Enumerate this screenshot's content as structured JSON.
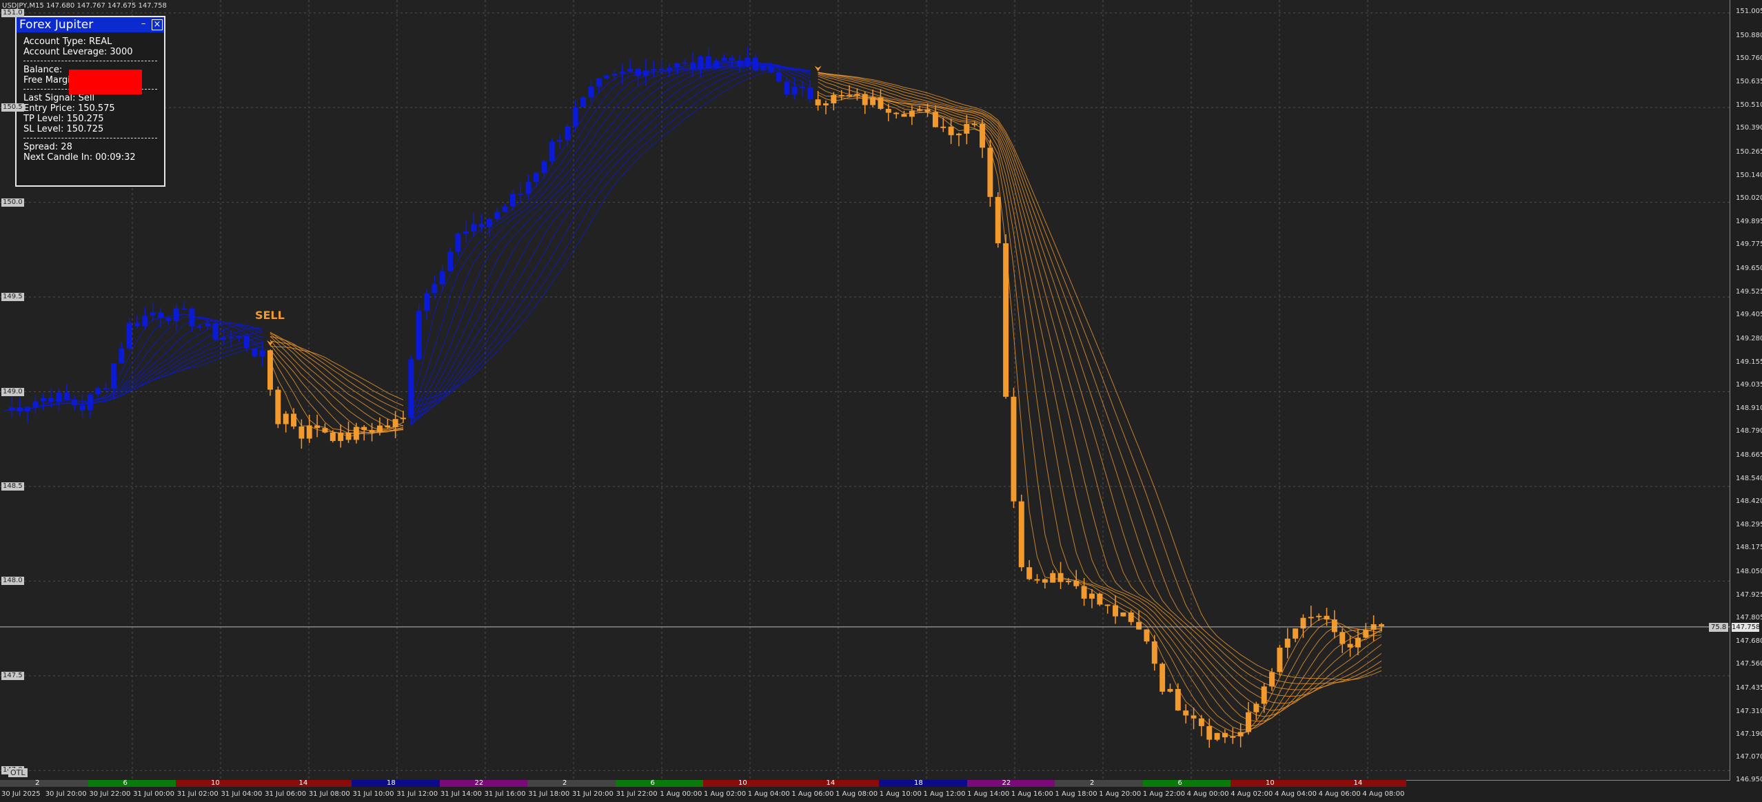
{
  "header": {
    "symbol_info": "USDJPY,M15  147.680 147.767 147.675 147.758"
  },
  "panel": {
    "title": "Forex Jupiter",
    "minimize": "–",
    "close": "×",
    "account_type": "Account Type: REAL",
    "leverage": "Account Leverage: 3000",
    "balance": "Balance:",
    "free_margin": "Free Margin",
    "last_signal": "Last Signal: Sell",
    "entry_price": "Entry Price: 150.575",
    "tp_level": "TP Level: 150.275",
    "sl_level": "SL Level: 150.725",
    "spread": "Spread: 28",
    "next_candle": "Next Candle In: 00:09:32"
  },
  "signals": {
    "sell_label": "SELL"
  },
  "price_axis": [
    "151.005",
    "150.880",
    "150.760",
    "150.635",
    "150.510",
    "150.390",
    "150.265",
    "150.140",
    "150.020",
    "149.895",
    "149.775",
    "149.650",
    "149.525",
    "149.405",
    "149.280",
    "149.155",
    "149.035",
    "148.910",
    "148.790",
    "148.665",
    "148.540",
    "148.420",
    "148.295",
    "148.175",
    "148.050",
    "147.925",
    "147.805",
    "147.680",
    "147.560",
    "147.435",
    "147.310",
    "147.190",
    "147.070",
    "146.950"
  ],
  "left_levels": [
    "151.0",
    "150.5",
    "150.0",
    "149.5",
    "149.0",
    "148.5",
    "148.0",
    "147.5",
    "147.0"
  ],
  "current_price": "147.758",
  "current_price_left": "75.8",
  "time_axis": [
    "30 Jul 2025",
    "30 Jul 20:00",
    "30 Jul 22:00",
    "31 Jul 00:00",
    "31 Jul 02:00",
    "31 Jul 04:00",
    "31 Jul 06:00",
    "31 Jul 08:00",
    "31 Jul 10:00",
    "31 Jul 12:00",
    "31 Jul 14:00",
    "31 Jul 16:00",
    "31 Jul 18:00",
    "31 Jul 20:00",
    "31 Jul 22:00",
    "1 Aug 00:00",
    "1 Aug 02:00",
    "1 Aug 04:00",
    "1 Aug 06:00",
    "1 Aug 08:00",
    "1 Aug 10:00",
    "1 Aug 12:00",
    "1 Aug 14:00",
    "1 Aug 16:00",
    "1 Aug 18:00",
    "1 Aug 20:00",
    "1 Aug 22:00",
    "4 Aug 00:00",
    "4 Aug 02:00",
    "4 Aug 04:00",
    "4 Aug 06:00",
    "4 Aug 08:00"
  ],
  "sessions": [
    {
      "num": "2",
      "color": "#444444"
    },
    {
      "num": "6",
      "color": "#0a7a0a"
    },
    {
      "num": "10",
      "color": "#8b0a0a"
    },
    {
      "num": "14",
      "color": "#8b0a0a"
    },
    {
      "num": "18",
      "color": "#0a0a8b"
    },
    {
      "num": "22",
      "color": "#7a0a7a"
    },
    {
      "num": "2",
      "color": "#444444"
    },
    {
      "num": "6",
      "color": "#0a7a0a"
    },
    {
      "num": "10",
      "color": "#8b0a0a"
    },
    {
      "num": "14",
      "color": "#8b0a0a"
    },
    {
      "num": "18",
      "color": "#0a0a8b"
    },
    {
      "num": "22",
      "color": "#7a0a7a"
    },
    {
      "num": "2",
      "color": "#444444"
    },
    {
      "num": "6",
      "color": "#0a7a0a"
    },
    {
      "num": "10",
      "color": "#8b0a0a"
    },
    {
      "num": "14",
      "color": "#8b0a0a"
    }
  ],
  "bottom_tag": "OTL",
  "colors": {
    "bull": "#0b1ad6",
    "bear": "#f29a2e",
    "bg": "#222222",
    "grid": "#555555"
  },
  "chart_data": {
    "type": "candlestick",
    "symbol": "USDJPY",
    "timeframe": "M15",
    "ylim": [
      146.95,
      151.05
    ],
    "close_path": [
      [
        0,
        148.9
      ],
      [
        6,
        148.98
      ],
      [
        10,
        148.92
      ],
      [
        13,
        149.05
      ],
      [
        16,
        149.35
      ],
      [
        19,
        149.42
      ],
      [
        23,
        149.4
      ],
      [
        27,
        149.3
      ],
      [
        30,
        149.28
      ],
      [
        33,
        149.18
      ],
      [
        35,
        148.85
      ],
      [
        36,
        148.88
      ],
      [
        38,
        148.78
      ],
      [
        40,
        148.82
      ],
      [
        43,
        148.75
      ],
      [
        46,
        148.8
      ],
      [
        49,
        148.82
      ],
      [
        51,
        148.85
      ],
      [
        52,
        149.2
      ],
      [
        53,
        149.45
      ],
      [
        55,
        149.6
      ],
      [
        58,
        149.82
      ],
      [
        60,
        149.85
      ],
      [
        63,
        149.95
      ],
      [
        66,
        150.05
      ],
      [
        70,
        150.3
      ],
      [
        73,
        150.48
      ],
      [
        76,
        150.62
      ],
      [
        80,
        150.7
      ],
      [
        84,
        150.72
      ],
      [
        88,
        150.72
      ],
      [
        91,
        150.76
      ],
      [
        94,
        150.75
      ],
      [
        96,
        150.7
      ],
      [
        98,
        150.68
      ],
      [
        100,
        150.6
      ],
      [
        104,
        150.55
      ],
      [
        108,
        150.55
      ],
      [
        112,
        150.52
      ],
      [
        116,
        150.48
      ],
      [
        118,
        150.45
      ],
      [
        120,
        150.4
      ],
      [
        122,
        150.38
      ],
      [
        124,
        150.45
      ],
      [
        125,
        150.3
      ],
      [
        127,
        149.8
      ],
      [
        128,
        148.95
      ],
      [
        129,
        148.45
      ],
      [
        130,
        148.1
      ],
      [
        132,
        148.0
      ],
      [
        134,
        148.05
      ],
      [
        137,
        147.98
      ],
      [
        140,
        147.88
      ],
      [
        143,
        147.8
      ],
      [
        146,
        147.7
      ],
      [
        148,
        147.45
      ],
      [
        150,
        147.35
      ],
      [
        152,
        147.3
      ],
      [
        154,
        147.2
      ],
      [
        156,
        147.18
      ],
      [
        158,
        147.2
      ],
      [
        160,
        147.35
      ],
      [
        162,
        147.55
      ],
      [
        165,
        147.75
      ],
      [
        168,
        147.82
      ],
      [
        170,
        147.7
      ],
      [
        172,
        147.65
      ],
      [
        174,
        147.72
      ],
      [
        176,
        147.758
      ]
    ],
    "signals": [
      {
        "type": "SELL",
        "index": 34,
        "price": 149.3
      },
      {
        "type": "SELL",
        "index": 104,
        "price": 150.75
      }
    ]
  }
}
